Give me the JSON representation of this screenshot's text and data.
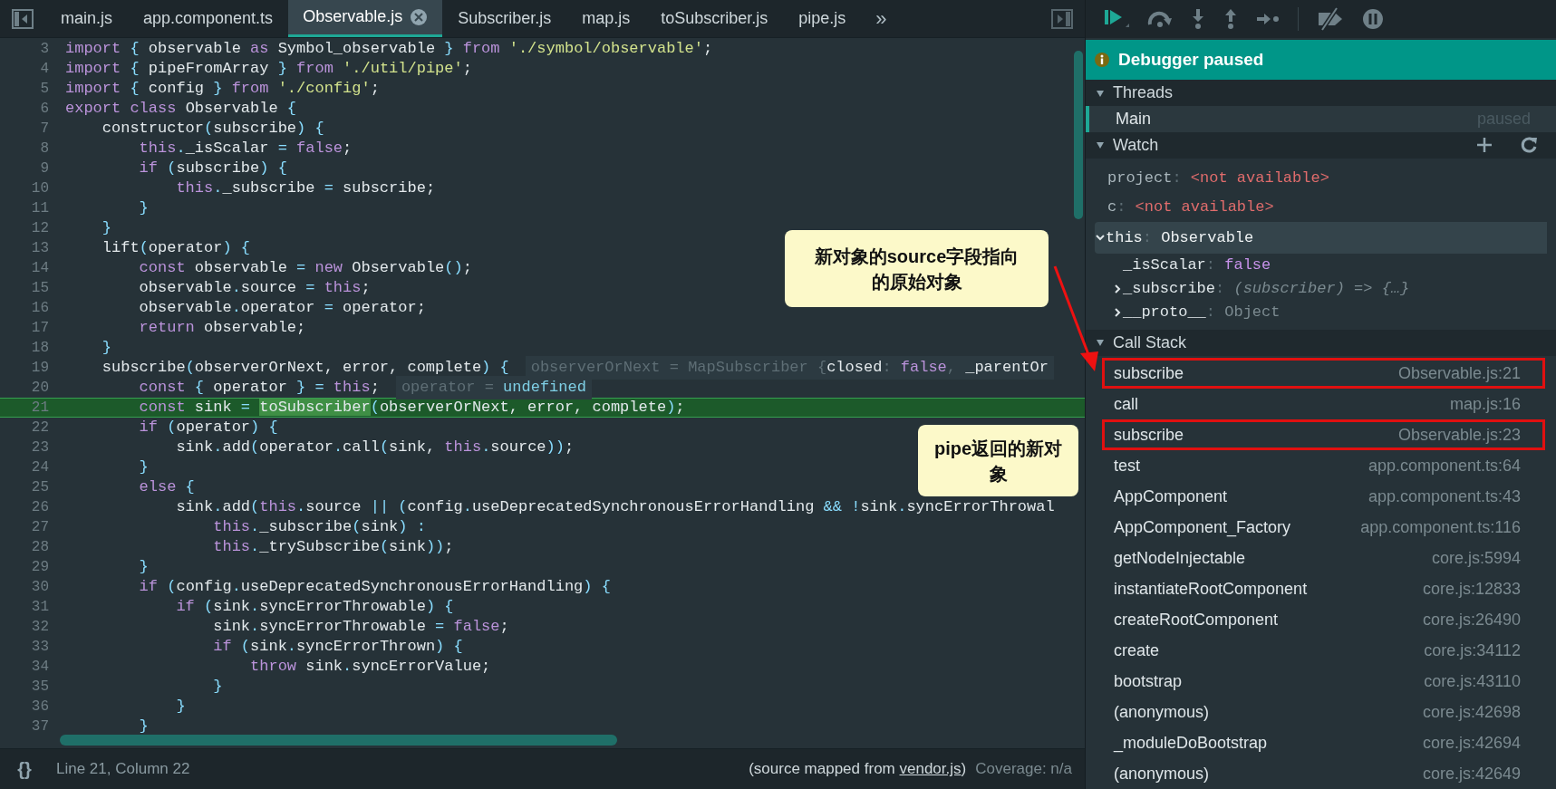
{
  "tabs": [
    {
      "label": "main.js",
      "selected": false
    },
    {
      "label": "app.component.ts",
      "selected": false
    },
    {
      "label": "Observable.js",
      "selected": true
    },
    {
      "label": "Subscriber.js",
      "selected": false
    },
    {
      "label": "map.js",
      "selected": false
    },
    {
      "label": "toSubscriber.js",
      "selected": false
    },
    {
      "label": "pipe.js",
      "selected": false
    }
  ],
  "tabs_overflow": "»",
  "code": {
    "lines": [
      {
        "number": "3",
        "current": false,
        "tokens": [
          {
            "kind": "keyword",
            "text": "import"
          },
          {
            "kind": "punct",
            "text": " {"
          },
          {
            "kind": "plain",
            "text": " observable "
          },
          {
            "kind": "keyword",
            "text": "as"
          },
          {
            "kind": "plain",
            "text": " Symbol_observable "
          },
          {
            "kind": "punct",
            "text": "}"
          },
          {
            "kind": "keyword",
            "text": " from"
          },
          {
            "kind": "string",
            "text": " './symbol/observable'"
          },
          {
            "kind": "plain",
            "text": ";"
          }
        ]
      },
      {
        "number": "4",
        "current": false,
        "tokens": [
          {
            "kind": "keyword",
            "text": "import"
          },
          {
            "kind": "punct",
            "text": " {"
          },
          {
            "kind": "plain",
            "text": " pipeFromArray "
          },
          {
            "kind": "punct",
            "text": "}"
          },
          {
            "kind": "keyword",
            "text": " from"
          },
          {
            "kind": "string",
            "text": " './util/pipe'"
          },
          {
            "kind": "plain",
            "text": ";"
          }
        ]
      },
      {
        "number": "5",
        "current": false,
        "tokens": [
          {
            "kind": "keyword",
            "text": "import"
          },
          {
            "kind": "punct",
            "text": " {"
          },
          {
            "kind": "plain",
            "text": " config "
          },
          {
            "kind": "punct",
            "text": "}"
          },
          {
            "kind": "keyword",
            "text": " from"
          },
          {
            "kind": "string",
            "text": " './config'"
          },
          {
            "kind": "plain",
            "text": ";"
          }
        ]
      },
      {
        "number": "6",
        "current": false,
        "tokens": [
          {
            "kind": "keyword",
            "text": "export"
          },
          {
            "kind": "keyword",
            "text": " class"
          },
          {
            "kind": "plain",
            "text": " Observable "
          },
          {
            "kind": "punct",
            "text": "{"
          }
        ]
      },
      {
        "number": "7",
        "current": false,
        "tokens": [
          {
            "kind": "plain",
            "text": "    constructor"
          },
          {
            "kind": "punct",
            "text": "("
          },
          {
            "kind": "plain",
            "text": "subscribe"
          },
          {
            "kind": "punct",
            "text": ") {"
          }
        ]
      },
      {
        "number": "8",
        "current": false,
        "tokens": [
          {
            "kind": "keyword",
            "text": "        this"
          },
          {
            "kind": "punct",
            "text": "."
          },
          {
            "kind": "plain",
            "text": "_isScalar "
          },
          {
            "kind": "punct",
            "text": "="
          },
          {
            "kind": "keyword",
            "text": " false"
          },
          {
            "kind": "plain",
            "text": ";"
          }
        ]
      },
      {
        "number": "9",
        "current": false,
        "tokens": [
          {
            "kind": "keyword",
            "text": "        if"
          },
          {
            "kind": "punct",
            "text": " ("
          },
          {
            "kind": "plain",
            "text": "subscribe"
          },
          {
            "kind": "punct",
            "text": ") {"
          }
        ]
      },
      {
        "number": "10",
        "current": false,
        "tokens": [
          {
            "kind": "keyword",
            "text": "            this"
          },
          {
            "kind": "punct",
            "text": "."
          },
          {
            "kind": "plain",
            "text": "_subscribe "
          },
          {
            "kind": "punct",
            "text": "="
          },
          {
            "kind": "plain",
            "text": " subscribe;"
          }
        ]
      },
      {
        "number": "11",
        "current": false,
        "tokens": [
          {
            "kind": "punct",
            "text": "        }"
          }
        ]
      },
      {
        "number": "12",
        "current": false,
        "tokens": [
          {
            "kind": "punct",
            "text": "    }"
          }
        ]
      },
      {
        "number": "13",
        "current": false,
        "tokens": [
          {
            "kind": "plain",
            "text": "    lift"
          },
          {
            "kind": "punct",
            "text": "("
          },
          {
            "kind": "plain",
            "text": "operator"
          },
          {
            "kind": "punct",
            "text": ") {"
          }
        ]
      },
      {
        "number": "14",
        "current": false,
        "tokens": [
          {
            "kind": "keyword",
            "text": "        const"
          },
          {
            "kind": "plain",
            "text": " observable "
          },
          {
            "kind": "punct",
            "text": "="
          },
          {
            "kind": "keyword",
            "text": " new"
          },
          {
            "kind": "plain",
            "text": " Observable"
          },
          {
            "kind": "punct",
            "text": "()"
          },
          {
            "kind": "plain",
            "text": ";"
          }
        ]
      },
      {
        "number": "15",
        "current": false,
        "tokens": [
          {
            "kind": "plain",
            "text": "        observable"
          },
          {
            "kind": "punct",
            "text": "."
          },
          {
            "kind": "plain",
            "text": "source "
          },
          {
            "kind": "punct",
            "text": "="
          },
          {
            "kind": "keyword",
            "text": " this"
          },
          {
            "kind": "plain",
            "text": ";"
          }
        ]
      },
      {
        "number": "16",
        "current": false,
        "tokens": [
          {
            "kind": "plain",
            "text": "        observable"
          },
          {
            "kind": "punct",
            "text": "."
          },
          {
            "kind": "plain",
            "text": "operator "
          },
          {
            "kind": "punct",
            "text": "="
          },
          {
            "kind": "plain",
            "text": " operator;"
          }
        ]
      },
      {
        "number": "17",
        "current": false,
        "tokens": [
          {
            "kind": "keyword",
            "text": "        return"
          },
          {
            "kind": "plain",
            "text": " observable;"
          }
        ]
      },
      {
        "number": "18",
        "current": false,
        "tokens": [
          {
            "kind": "punct",
            "text": "    }"
          }
        ]
      },
      {
        "number": "19",
        "current": false,
        "tokens": [
          {
            "kind": "plain",
            "text": "    subscribe"
          },
          {
            "kind": "punct",
            "text": "("
          },
          {
            "kind": "plain",
            "text": "observerOrNext, error, complete"
          },
          {
            "kind": "punct",
            "text": ") {"
          }
        ],
        "hint": [
          {
            "kind": "hint",
            "text": "observerOrNext = MapSubscriber {"
          },
          {
            "kind": "plain",
            "text": "closed"
          },
          {
            "kind": "hint",
            "text": ": "
          },
          {
            "kind": "keyword",
            "text": "false"
          },
          {
            "kind": "hint",
            "text": ", "
          },
          {
            "kind": "plain",
            "text": "_parentOr"
          }
        ]
      },
      {
        "number": "20",
        "current": false,
        "tokens": [
          {
            "kind": "keyword",
            "text": "        const"
          },
          {
            "kind": "punct",
            "text": " {"
          },
          {
            "kind": "plain",
            "text": " operator "
          },
          {
            "kind": "punct",
            "text": "} ="
          },
          {
            "kind": "keyword",
            "text": " this"
          },
          {
            "kind": "plain",
            "text": ";"
          }
        ],
        "hint": [
          {
            "kind": "hint",
            "text": "operator = "
          },
          {
            "kind": "hintvalue",
            "text": "undefined"
          }
        ]
      },
      {
        "number": "21",
        "current": true,
        "tokens": [
          {
            "kind": "keyword",
            "text": "        const"
          },
          {
            "kind": "plain",
            "text": " sink "
          },
          {
            "kind": "punct",
            "text": "= "
          },
          {
            "kind": "match",
            "text": "toSubscriber"
          },
          {
            "kind": "punct",
            "text": "("
          },
          {
            "kind": "plain",
            "text": "observerOrNext, error, complete"
          },
          {
            "kind": "punct",
            "text": ")"
          },
          {
            "kind": "plain",
            "text": ";"
          }
        ]
      },
      {
        "number": "22",
        "current": false,
        "tokens": [
          {
            "kind": "keyword",
            "text": "        if"
          },
          {
            "kind": "punct",
            "text": " ("
          },
          {
            "kind": "plain",
            "text": "operator"
          },
          {
            "kind": "punct",
            "text": ") {"
          }
        ]
      },
      {
        "number": "23",
        "current": false,
        "tokens": [
          {
            "kind": "plain",
            "text": "            sink"
          },
          {
            "kind": "punct",
            "text": "."
          },
          {
            "kind": "plain",
            "text": "add"
          },
          {
            "kind": "punct",
            "text": "("
          },
          {
            "kind": "plain",
            "text": "operator"
          },
          {
            "kind": "punct",
            "text": "."
          },
          {
            "kind": "plain",
            "text": "call"
          },
          {
            "kind": "punct",
            "text": "("
          },
          {
            "kind": "plain",
            "text": "sink, "
          },
          {
            "kind": "keyword",
            "text": "this"
          },
          {
            "kind": "punct",
            "text": "."
          },
          {
            "kind": "plain",
            "text": "source"
          },
          {
            "kind": "punct",
            "text": "))"
          },
          {
            "kind": "plain",
            "text": ";"
          }
        ]
      },
      {
        "number": "24",
        "current": false,
        "tokens": [
          {
            "kind": "punct",
            "text": "        }"
          }
        ]
      },
      {
        "number": "25",
        "current": false,
        "tokens": [
          {
            "kind": "keyword",
            "text": "        else"
          },
          {
            "kind": "punct",
            "text": " {"
          }
        ]
      },
      {
        "number": "26",
        "current": false,
        "tokens": [
          {
            "kind": "plain",
            "text": "            sink"
          },
          {
            "kind": "punct",
            "text": "."
          },
          {
            "kind": "plain",
            "text": "add"
          },
          {
            "kind": "punct",
            "text": "("
          },
          {
            "kind": "keyword",
            "text": "this"
          },
          {
            "kind": "punct",
            "text": "."
          },
          {
            "kind": "plain",
            "text": "source "
          },
          {
            "kind": "punct",
            "text": "|| ("
          },
          {
            "kind": "plain",
            "text": "config"
          },
          {
            "kind": "punct",
            "text": "."
          },
          {
            "kind": "plain",
            "text": "useDeprecatedSynchronousErrorHandling "
          },
          {
            "kind": "punct",
            "text": "&& !"
          },
          {
            "kind": "plain",
            "text": "sink"
          },
          {
            "kind": "punct",
            "text": "."
          },
          {
            "kind": "plain",
            "text": "syncErrorThrowal"
          }
        ]
      },
      {
        "number": "27",
        "current": false,
        "tokens": [
          {
            "kind": "keyword",
            "text": "                this"
          },
          {
            "kind": "punct",
            "text": "."
          },
          {
            "kind": "plain",
            "text": "_subscribe"
          },
          {
            "kind": "punct",
            "text": "("
          },
          {
            "kind": "plain",
            "text": "sink"
          },
          {
            "kind": "punct",
            "text": ") :"
          }
        ]
      },
      {
        "number": "28",
        "current": false,
        "tokens": [
          {
            "kind": "keyword",
            "text": "                this"
          },
          {
            "kind": "punct",
            "text": "."
          },
          {
            "kind": "plain",
            "text": "_trySubscribe"
          },
          {
            "kind": "punct",
            "text": "("
          },
          {
            "kind": "plain",
            "text": "sink"
          },
          {
            "kind": "punct",
            "text": "))"
          },
          {
            "kind": "plain",
            "text": ";"
          }
        ]
      },
      {
        "number": "29",
        "current": false,
        "tokens": [
          {
            "kind": "punct",
            "text": "        }"
          }
        ]
      },
      {
        "number": "30",
        "current": false,
        "tokens": [
          {
            "kind": "keyword",
            "text": "        if"
          },
          {
            "kind": "punct",
            "text": " ("
          },
          {
            "kind": "plain",
            "text": "config"
          },
          {
            "kind": "punct",
            "text": "."
          },
          {
            "kind": "plain",
            "text": "useDeprecatedSynchronousErrorHandling"
          },
          {
            "kind": "punct",
            "text": ") {"
          }
        ]
      },
      {
        "number": "31",
        "current": false,
        "tokens": [
          {
            "kind": "keyword",
            "text": "            if"
          },
          {
            "kind": "punct",
            "text": " ("
          },
          {
            "kind": "plain",
            "text": "sink"
          },
          {
            "kind": "punct",
            "text": "."
          },
          {
            "kind": "plain",
            "text": "syncErrorThrowable"
          },
          {
            "kind": "punct",
            "text": ") {"
          }
        ]
      },
      {
        "number": "32",
        "current": false,
        "tokens": [
          {
            "kind": "plain",
            "text": "                sink"
          },
          {
            "kind": "punct",
            "text": "."
          },
          {
            "kind": "plain",
            "text": "syncErrorThrowable "
          },
          {
            "kind": "punct",
            "text": "="
          },
          {
            "kind": "keyword",
            "text": " false"
          },
          {
            "kind": "plain",
            "text": ";"
          }
        ]
      },
      {
        "number": "33",
        "current": false,
        "tokens": [
          {
            "kind": "keyword",
            "text": "                if"
          },
          {
            "kind": "punct",
            "text": " ("
          },
          {
            "kind": "plain",
            "text": "sink"
          },
          {
            "kind": "punct",
            "text": "."
          },
          {
            "kind": "plain",
            "text": "syncErrorThrown"
          },
          {
            "kind": "punct",
            "text": ") {"
          }
        ]
      },
      {
        "number": "34",
        "current": false,
        "tokens": [
          {
            "kind": "keyword",
            "text": "                    throw"
          },
          {
            "kind": "plain",
            "text": " sink"
          },
          {
            "kind": "punct",
            "text": "."
          },
          {
            "kind": "plain",
            "text": "syncErrorValue;"
          }
        ]
      },
      {
        "number": "35",
        "current": false,
        "tokens": [
          {
            "kind": "punct",
            "text": "                }"
          }
        ]
      },
      {
        "number": "36",
        "current": false,
        "tokens": [
          {
            "kind": "punct",
            "text": "            }"
          }
        ]
      },
      {
        "number": "37",
        "current": false,
        "tokens": [
          {
            "kind": "punct",
            "text": "        }"
          }
        ]
      }
    ]
  },
  "status_bar": {
    "pretty_print": "{}",
    "cursor": "Line 21, Column 22",
    "source_before": "(source mapped from ",
    "source_link": "vendor.js",
    "source_after": ")",
    "coverage": "Coverage: n/a"
  },
  "debugger": {
    "banner": "Debugger paused",
    "threads": {
      "title": "Threads",
      "expanded": true,
      "items": [
        {
          "name": "Main",
          "status": "paused",
          "selected": true
        }
      ]
    },
    "watch": {
      "title": "Watch",
      "expanded": true,
      "items": [
        {
          "name": "project",
          "separator": ":",
          "value": "<not available>",
          "kind": "error",
          "selected": false
        },
        {
          "name": "c",
          "separator": ":",
          "value": "<not available>",
          "kind": "error",
          "selected": false
        },
        {
          "name": "this",
          "separator": ":",
          "value": "Observable",
          "kind": "type",
          "selected": true,
          "expanded": true,
          "children": [
            {
              "name": "_isScalar",
              "separator": ":",
              "value": "false",
              "kind": "boolean"
            },
            {
              "name": "_subscribe",
              "separator": ":",
              "value": "(subscriber) => {…}",
              "kind": "function",
              "expanded": false
            },
            {
              "name": "__proto__",
              "separator": ":",
              "value": "Object",
              "kind": "object",
              "expanded": false
            }
          ]
        }
      ]
    },
    "call_stack": {
      "title": "Call Stack",
      "expanded": true,
      "items": [
        {
          "function": "subscribe",
          "location": "Observable.js:21",
          "boxed": true
        },
        {
          "function": "call",
          "location": "map.js:16",
          "boxed": false
        },
        {
          "function": "subscribe",
          "location": "Observable.js:23",
          "boxed": true
        },
        {
          "function": "test",
          "location": "app.component.ts:64",
          "boxed": false
        },
        {
          "function": "AppComponent",
          "location": "app.component.ts:43",
          "boxed": false
        },
        {
          "function": "AppComponent_Factory",
          "location": "app.component.ts:116",
          "boxed": false
        },
        {
          "function": "getNodeInjectable",
          "location": "core.js:5994",
          "boxed": false
        },
        {
          "function": "instantiateRootComponent",
          "location": "core.js:12833",
          "boxed": false
        },
        {
          "function": "createRootComponent",
          "location": "core.js:26490",
          "boxed": false
        },
        {
          "function": "create",
          "location": "core.js:34112",
          "boxed": false
        },
        {
          "function": "bootstrap",
          "location": "core.js:43110",
          "boxed": false
        },
        {
          "function": "(anonymous)",
          "location": "core.js:42698",
          "boxed": false
        },
        {
          "function": "_moduleDoBootstrap",
          "location": "core.js:42694",
          "boxed": false
        },
        {
          "function": "(anonymous)",
          "location": "core.js:42649",
          "boxed": false
        }
      ]
    }
  },
  "callouts": [
    {
      "text": "新对象的source字段指向的原始对象"
    },
    {
      "text": "pipe返回的新对象"
    }
  ]
}
